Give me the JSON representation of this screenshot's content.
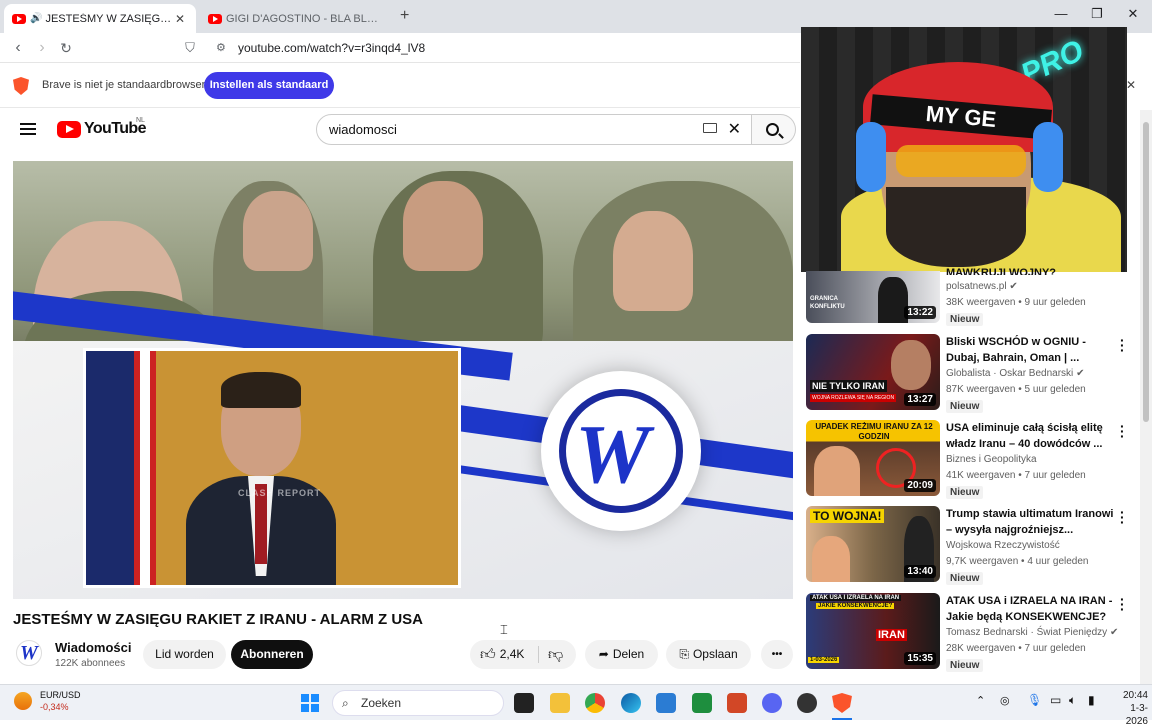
{
  "browser": {
    "tabs": [
      {
        "label": "JESTEŚMY W ZASIĘGU RAKIET",
        "active": true
      },
      {
        "label": "GIGI D'AGOSTINO - BLA BLA BLA ( O",
        "active": false
      }
    ],
    "new_tab": "+",
    "url": "youtube.com/watch?v=r3inqd4_lV8",
    "infobar": {
      "message": "Brave is niet je standaardbrowser",
      "button": "Instellen als standaard"
    },
    "window_controls": {
      "minimize": "—",
      "maximize": "❐",
      "close": "✕"
    }
  },
  "youtube": {
    "logo_text": "YouTube",
    "country_code": "NL",
    "search_value": "wiadomosci",
    "video": {
      "title": "JESTEŚMY W ZASIĘGU RAKIET Z IRANU - ALARM Z USA",
      "watermark": "CLASH REPORT",
      "channel": "Wiadomości",
      "subscribers": "122K abonnees",
      "join_label": "Lid worden",
      "subscribe_label": "Abonneren",
      "likes": "2,4K",
      "share_label": "Delen",
      "save_label": "Opslaan",
      "more_label": "•••"
    },
    "webcam": {
      "cap_text": "MY GE",
      "neon_text": "PRO"
    },
    "sidebar": [
      {
        "title": "",
        "title_partial": "MAWKRUJI WOJNY?",
        "channel": "polsatnews.pl",
        "verified": true,
        "meta": "38K weergaven • 9 uur geleden",
        "badge": "Nieuw",
        "duration": "13:22",
        "thumb_text": "GRANICA KONFLIKTU"
      },
      {
        "title": "Bliski WSCHÓD w OGNIU - Dubaj, Bahrain, Oman | ...",
        "channel": "Globalista · Oskar Bednarski",
        "verified": true,
        "meta": "87K weergaven • 5 uur geleden",
        "badge": "Nieuw",
        "duration": "13:27",
        "thumb_text": "NIE TYLKO IRAN",
        "thumb_sub": "WOJNA ROZLEWA SIĘ NA REGION"
      },
      {
        "title": "USA eliminuje całą ścisłą elitę władz Iranu – 40 dowódców ...",
        "channel": "Biznes i Geopolityka",
        "verified": false,
        "meta": "41K weergaven • 7 uur geleden",
        "badge": "Nieuw",
        "duration": "20:09",
        "thumb_text": "UPADEK REŻIMU IRANU ZA 12 GODZIN"
      },
      {
        "title": "Trump stawia ultimatum Iranowi – wysyła najgroźniejsz...",
        "channel": "Wojskowa Rzeczywistość",
        "verified": false,
        "meta": "9,7K weergaven • 4 uur geleden",
        "badge": "Nieuw",
        "duration": "13:40",
        "thumb_text": "TO WOJNA!"
      },
      {
        "title": "ATAK USA i IZRAELA NA IRAN - Jakie będą KONSEKWENCJE?",
        "channel": "Tomasz Bednarski · Świat Pieniędzy",
        "verified": true,
        "meta": "28K weergaven • 7 uur geleden",
        "badge": "Nieuw",
        "duration": "15:35",
        "thumb_text": "ATAK USA I IZRAELA NA IRAN",
        "thumb_sub": "JAKIE KONSEKWENCJE?",
        "thumb_date": "1-03-2026",
        "thumb_iran": "IRAN"
      }
    ]
  },
  "taskbar": {
    "weather_pair": "EUR/USD",
    "weather_change": "-0,34%",
    "search_placeholder": "Zoeken",
    "time": "20:44",
    "date": "1-3-2026"
  },
  "colors": {
    "brave_accent": "#3f39e8",
    "youtube_red": "#ff0000",
    "logo_blue": "#1d34c8"
  }
}
